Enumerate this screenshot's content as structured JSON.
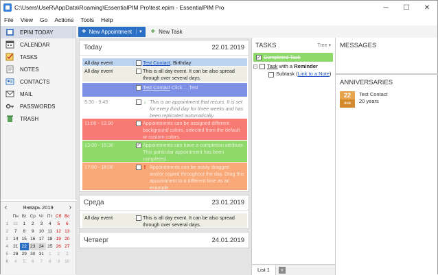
{
  "window": {
    "title": "C:\\Users\\UseR\\AppData\\Roaming\\EssentialPIM Pro\\test.epim - EssentialPIM Pro",
    "minimize": "─",
    "maximize": "☐",
    "close": "✕"
  },
  "menu": [
    "File",
    "View",
    "Go",
    "Actions",
    "Tools",
    "Help"
  ],
  "nav": [
    {
      "label": "EPIM TODAY",
      "icon": "home-icon"
    },
    {
      "label": "CALENDAR",
      "icon": "calendar-icon"
    },
    {
      "label": "TASKS",
      "icon": "checklist-icon"
    },
    {
      "label": "NOTES",
      "icon": "note-icon"
    },
    {
      "label": "CONTACTS",
      "icon": "contact-card-icon"
    },
    {
      "label": "MAIL",
      "icon": "envelope-icon"
    },
    {
      "label": "PASSWORDS",
      "icon": "key-icon"
    },
    {
      "label": "TRASH",
      "icon": "trash-icon"
    }
  ],
  "toolbar": {
    "new_appointment": "New Appointment",
    "new_task": "New Task"
  },
  "mini_calendar": {
    "month": "Январь 2019",
    "prev": "‹",
    "next": "›",
    "weekdays": [
      "Пн",
      "Вт",
      "Ср",
      "Чт",
      "Пт",
      "Сб",
      "Вс"
    ],
    "weeks": [
      {
        "wk": "1",
        "days": [
          "31",
          "1",
          "2",
          "3",
          "4",
          "5",
          "6"
        ]
      },
      {
        "wk": "2",
        "days": [
          "7",
          "8",
          "9",
          "10",
          "11",
          "12",
          "13"
        ]
      },
      {
        "wk": "3",
        "days": [
          "14",
          "15",
          "16",
          "17",
          "18",
          "19",
          "20"
        ]
      },
      {
        "wk": "4",
        "days": [
          "21",
          "22",
          "23",
          "24",
          "25",
          "26",
          "27"
        ]
      },
      {
        "wk": "5",
        "days": [
          "28",
          "29",
          "30",
          "31",
          "1",
          "2",
          "3"
        ]
      },
      {
        "wk": "6",
        "days": [
          "4",
          "5",
          "6",
          "7",
          "8",
          "9",
          "10"
        ]
      }
    ]
  },
  "days": [
    {
      "name": "Today",
      "date": "22.01.2019",
      "events": [
        {
          "time": "All day event",
          "pre": "",
          "link": "Test Contact",
          "post": ", Birthday",
          "bg": "#bcd3f0"
        },
        {
          "time": "All day event",
          "pre": "This is all day event. It can be also spread through over several days.",
          "link": "",
          "post": "",
          "bg": "#eeeee4"
        },
        {
          "time": "",
          "pre": "",
          "link": "Test Contact",
          "post": "  Click ... Test",
          "bg": "#7e8fe6"
        },
        {
          "time": "8:30 - 9:45",
          "mark": "↓",
          "pre": "This is an appointment that recurs. It is set for every third day for three weeks and has been replicated automatically.",
          "link": "",
          "post": "",
          "bg": "#ffffff"
        },
        {
          "time": "11:00 - 12:00",
          "pre": "Appointments can be assigned different background colors, selected from the default or custom colors.",
          "link": "",
          "post": "",
          "bg": "#f77b72"
        },
        {
          "time": "13:00 - 15:30",
          "pre": "Appointments can have a completion attribute. This particular appointment has been completed.",
          "link": "",
          "post": "",
          "bg": "#8fd86a"
        },
        {
          "time": "17:00 - 18:00",
          "mark": "!",
          "pre": "Appointments can be easily dragged and/or copied throughout the day. Drag this appointment to a different time as an example.",
          "link": "",
          "post": "",
          "bg": "#f9a978"
        }
      ]
    },
    {
      "name": "Среда",
      "date": "23.01.2019",
      "events": [
        {
          "time": "All day event",
          "pre": "This is all day event. It can be also spread through over several days.",
          "link": "",
          "post": "",
          "bg": "#eeeee4"
        }
      ]
    },
    {
      "name": "Четверг",
      "date": "24.01.2019",
      "events": []
    }
  ],
  "tasks": {
    "title": "TASKS",
    "view": "Tree ▾",
    "items": [
      {
        "text": "Completed Task"
      },
      {
        "text_link": "Task",
        "text_post": " with a ",
        "text_bold": "Reminder"
      },
      {
        "text": "Subtask (",
        "link": "Link to a Note",
        "post": ")"
      }
    ],
    "list_tab": "List 1",
    "add": "+"
  },
  "messages": {
    "title": "MESSAGES"
  },
  "anniversaries": {
    "title": "ANNIVERSARIES",
    "day": "22",
    "month": "янв",
    "name": "Test Contact",
    "years": "20 years"
  },
  "colors": {
    "accent": "#2b6fc4",
    "birthday_bg": "#bcd3f0",
    "allday_bg": "#eeeee4",
    "red_bg": "#f77b72",
    "green_bg": "#8fd86a",
    "orange_bg": "#f9a978",
    "purple_bg": "#7e8fe6",
    "completed_task_bg": "#8fd86a",
    "anniversary": "#e8a54d"
  }
}
